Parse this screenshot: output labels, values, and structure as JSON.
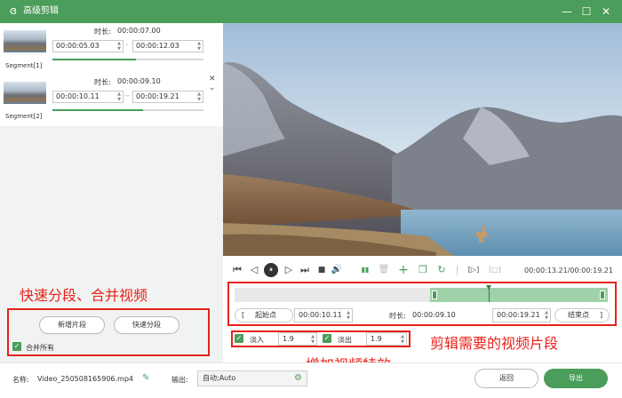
{
  "app": {
    "title": "高级剪辑",
    "min_glyph": "—",
    "max_glyph": "☐",
    "close_glyph": "✕"
  },
  "segments": [
    {
      "label": "Segment[1]",
      "duration_label": "时长:",
      "duration": "00:00:07.00",
      "start": "00:00:05.03",
      "end": "00:00:12.03",
      "separator": "-",
      "progress": 0.55
    },
    {
      "label": "Segment[2]",
      "duration_label": "时长:",
      "duration": "00:00:09.10",
      "start": "00:00:10.11",
      "end": "00:00:19.21",
      "separator": "--",
      "progress": 0.6,
      "close_glyph": "✕",
      "chevron_glyph": "⌄"
    }
  ],
  "annotations": {
    "split_merge": "快速分段、合并视频",
    "clip_segment": "剪辑需要的视频片段",
    "effects": "增加视频特效"
  },
  "left_controls": {
    "add_segment": "新增片段",
    "quick_split": "快速分段",
    "merge_all": "合并所有",
    "check_glyph": "✓"
  },
  "playback": {
    "current_time": "00:00:13.21",
    "total_time": "00:00:19.21",
    "time_display": "00:00:13.21/00:00:19.21",
    "glyphs": {
      "prev": "⏮",
      "back": "◁",
      "pause": "⏸",
      "fwd": "▷",
      "next": "⏭",
      "stop": "■",
      "volume": "🔊",
      "split": "▮▮",
      "delete": "🗑",
      "add": "+",
      "copy": "❐",
      "reset": "↻",
      "mark_in": "[▷]",
      "mark_out": "[▢]"
    }
  },
  "timeline": {
    "selection_start_fraction": 0.524,
    "playhead_fraction": 0.68
  },
  "trim": {
    "start_label": "起始点",
    "start_bracket": "[",
    "start_value": "00:00:10.11",
    "duration_label": "时长:",
    "duration_value": "00:00:09.10",
    "end_value": "00:00:19.21",
    "end_label": "结束点",
    "end_bracket": "]"
  },
  "effects": {
    "fade_in_label": "淡入",
    "fade_in_value": "1.9",
    "fade_out_label": "淡出",
    "fade_out_value": "1.9"
  },
  "bottom": {
    "name_label": "名称:",
    "file_name": "Video_250508165906.mp4",
    "output_label": "输出:",
    "output_value": "自动;Auto",
    "back_button": "返回",
    "export_button": "导出"
  },
  "colors": {
    "accent": "#4a9d5a",
    "annotation": "#e8221b"
  }
}
